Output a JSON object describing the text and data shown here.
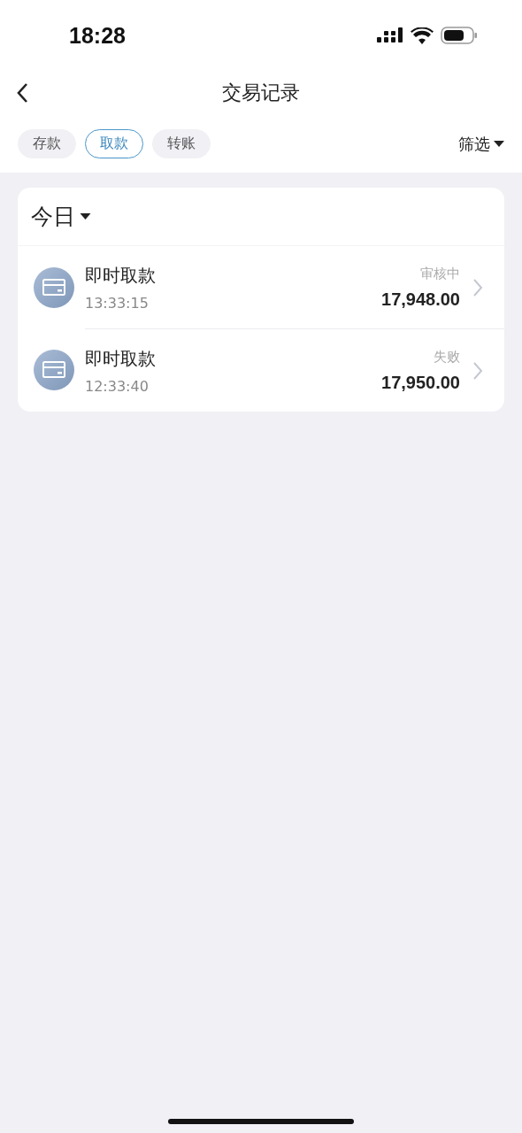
{
  "status_bar": {
    "time": "18:28"
  },
  "header": {
    "title": "交易记录"
  },
  "tabs": [
    {
      "label": "存款",
      "selected": false
    },
    {
      "label": "取款",
      "selected": true
    },
    {
      "label": "转账",
      "selected": false
    }
  ],
  "filter": {
    "label": "筛选"
  },
  "section": {
    "title": "今日"
  },
  "transactions": [
    {
      "title": "即时取款",
      "time": "13:33:15",
      "status": "审核中",
      "amount": "17,948.00"
    },
    {
      "title": "即时取款",
      "time": "12:33:40",
      "status": "失败",
      "amount": "17,950.00"
    }
  ]
}
